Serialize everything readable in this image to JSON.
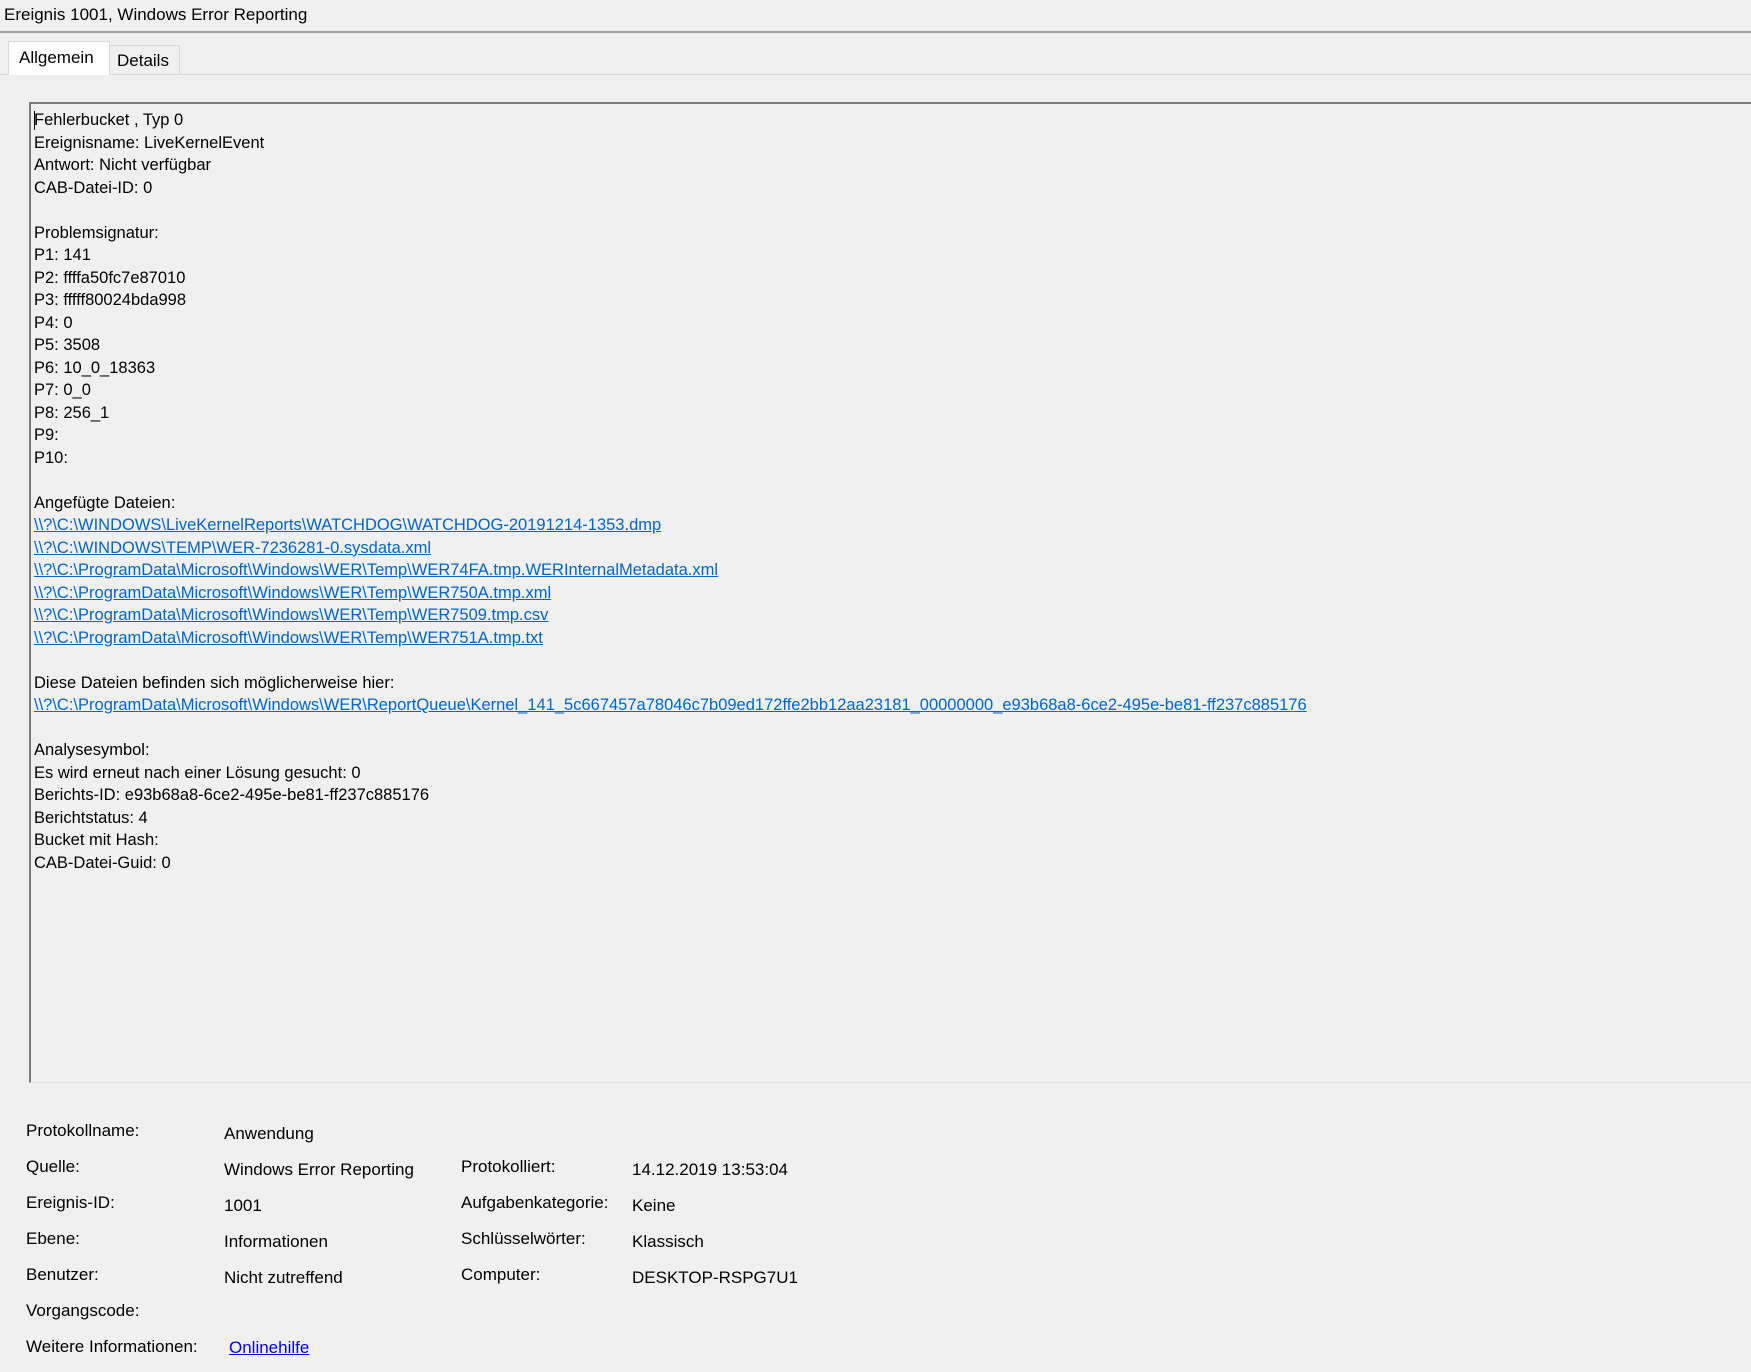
{
  "window": {
    "title": "Ereignis 1001, Windows Error Reporting"
  },
  "tabs": [
    {
      "label": "Allgemein",
      "active": true
    },
    {
      "label": "Details",
      "active": false
    }
  ],
  "description": {
    "lines": [
      {
        "text": "Fehlerbucket , Typ 0",
        "link": false
      },
      {
        "text": "Ereignisname: LiveKernelEvent",
        "link": false
      },
      {
        "text": "Antwort: Nicht verfügbar",
        "link": false
      },
      {
        "text": "CAB-Datei-ID: 0",
        "link": false
      },
      {
        "text": "",
        "link": false
      },
      {
        "text": "Problemsignatur:",
        "link": false
      },
      {
        "text": "P1: 141",
        "link": false
      },
      {
        "text": "P2: ffffa50fc7e87010",
        "link": false
      },
      {
        "text": "P3: fffff80024bda998",
        "link": false
      },
      {
        "text": "P4: 0",
        "link": false
      },
      {
        "text": "P5: 3508",
        "link": false
      },
      {
        "text": "P6: 10_0_18363",
        "link": false
      },
      {
        "text": "P7: 0_0",
        "link": false
      },
      {
        "text": "P8: 256_1",
        "link": false
      },
      {
        "text": "P9:",
        "link": false
      },
      {
        "text": "P10:",
        "link": false
      },
      {
        "text": "",
        "link": false
      },
      {
        "text": "Angefügte Dateien:",
        "link": false
      },
      {
        "text": "\\\\?\\C:\\WINDOWS\\LiveKernelReports\\WATCHDOG\\WATCHDOG-20191214-1353.dmp",
        "link": true
      },
      {
        "text": "\\\\?\\C:\\WINDOWS\\TEMP\\WER-7236281-0.sysdata.xml",
        "link": true
      },
      {
        "text": "\\\\?\\C:\\ProgramData\\Microsoft\\Windows\\WER\\Temp\\WER74FA.tmp.WERInternalMetadata.xml",
        "link": true
      },
      {
        "text": "\\\\?\\C:\\ProgramData\\Microsoft\\Windows\\WER\\Temp\\WER750A.tmp.xml",
        "link": true
      },
      {
        "text": "\\\\?\\C:\\ProgramData\\Microsoft\\Windows\\WER\\Temp\\WER7509.tmp.csv",
        "link": true
      },
      {
        "text": "\\\\?\\C:\\ProgramData\\Microsoft\\Windows\\WER\\Temp\\WER751A.tmp.txt",
        "link": true
      },
      {
        "text": "",
        "link": false
      },
      {
        "text": "Diese Dateien befinden sich möglicherweise hier:",
        "link": false
      },
      {
        "text": "\\\\?\\C:\\ProgramData\\Microsoft\\Windows\\WER\\ReportQueue\\Kernel_141_5c667457a78046c7b09ed172ffe2bb12aa23181_00000000_e93b68a8-6ce2-495e-be81-ff237c885176",
        "link": true
      },
      {
        "text": "",
        "link": false
      },
      {
        "text": "Analysesymbol:",
        "link": false
      },
      {
        "text": "Es wird erneut nach einer Lösung gesucht: 0",
        "link": false
      },
      {
        "text": "Berichts-ID: e93b68a8-6ce2-495e-be81-ff237c885176",
        "link": false
      },
      {
        "text": "Berichtstatus: 4",
        "link": false
      },
      {
        "text": "Bucket mit Hash:",
        "link": false
      },
      {
        "text": "CAB-Datei-Guid: 0",
        "link": false
      }
    ]
  },
  "fields": {
    "protokollname_label": "Protokollname:",
    "protokollname_value": "Anwendung",
    "quelle_label": "Quelle:",
    "quelle_value": "Windows Error Reporting",
    "protokolliert_label": "Protokolliert:",
    "protokolliert_value": "14.12.2019 13:53:04",
    "ereignis_id_label": "Ereignis-ID:",
    "ereignis_id_value": "1001",
    "aufgabenkategorie_label": "Aufgabenkategorie:",
    "aufgabenkategorie_value": "Keine",
    "ebene_label": "Ebene:",
    "ebene_value": "Informationen",
    "schluesselwoerter_label": "Schlüsselwörter:",
    "schluesselwoerter_value": "Klassisch",
    "benutzer_label": "Benutzer:",
    "benutzer_value": "Nicht zutreffend",
    "computer_label": "Computer:",
    "computer_value": "DESKTOP-RSPG7U1",
    "vorgangscode_label": "Vorgangscode:",
    "vorgangscode_value": "",
    "weitere_label": "Weitere Informationen:",
    "weitere_link": "Onlinehilfe"
  },
  "colors": {
    "link": "#0066cc",
    "help_link": "#0000ee",
    "background": "#f0f0f0"
  }
}
